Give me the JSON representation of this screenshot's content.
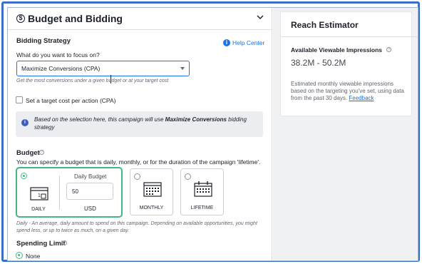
{
  "header": {
    "title": "Budget and Bidding",
    "collapse_icon": "chevron-up-icon"
  },
  "bidding": {
    "section_label": "Bidding Strategy",
    "help_label": "Help Center",
    "focus_question": "What do you want to focus on?",
    "selected_option": "Maximize Conversions (CPA)",
    "hint": "Get the most conversions under a given budget or at your target cost",
    "target_cost_checkbox_label": "Set a target cost per action (CPA)",
    "target_cost_checked": false,
    "info_prefix": "Based on the selection here, this campaign will use ",
    "info_strategy": "Maximize Conversions",
    "info_suffix": " bidding strategy"
  },
  "budget": {
    "section_label": "Budget",
    "description": "You can specify a budget that is daily, monthly, or for the duration of the campaign 'lifetime'.",
    "options": [
      {
        "label": "DAILY",
        "selected": true,
        "icon": "daily-calendar-icon",
        "icon_text": "1"
      },
      {
        "label": "MONTHLY",
        "selected": false,
        "icon": "monthly-calendar-icon"
      },
      {
        "label": "LIFETIME",
        "selected": false,
        "icon": "lifetime-calendar-icon"
      }
    ],
    "daily_budget_label": "Daily Budget",
    "daily_budget_value": "50",
    "currency": "USD",
    "footnote": "Daily - An average, daily amount to spend on this campaign. Depending on available opportunities, you might spend less, or up to twice as much, on a given day."
  },
  "spending_limit": {
    "label": "Spending Limit",
    "selected_option": "None"
  },
  "reach": {
    "title": "Reach Estimator",
    "impressions_label": "Available Viewable Impressions",
    "impressions_value": "38.2M - 50.2M",
    "note": "Estimated monthly viewable impressions based on the targeting you've set, using data from the past 30 days.",
    "feedback_link": "Feedback"
  },
  "colors": {
    "frame": "#3b6fc7",
    "accent": "#1a73e8",
    "selected_card": "#42b883"
  }
}
